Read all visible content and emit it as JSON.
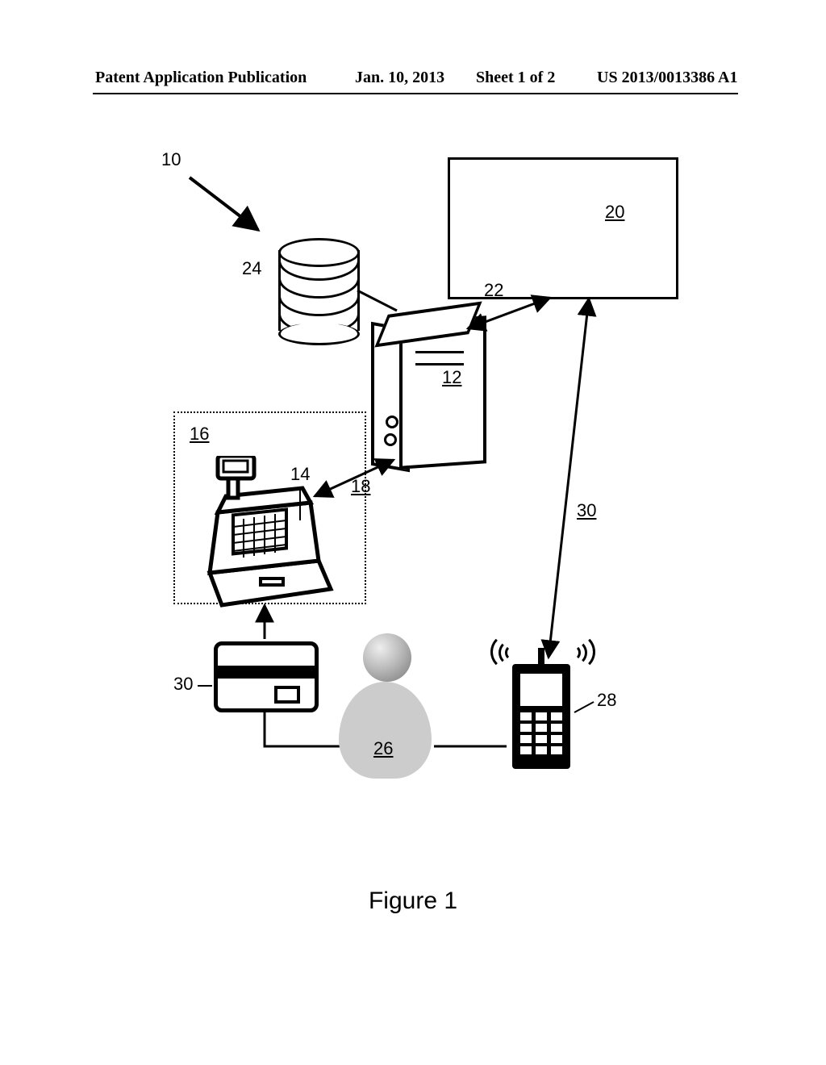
{
  "header": {
    "left": "Patent Application Publication",
    "date": "Jan. 10, 2013",
    "sheet": "Sheet 1 of 2",
    "pubno": "US 2013/0013386 A1"
  },
  "caption": "Figure 1",
  "refs": {
    "r10": "10",
    "r12": "12",
    "r14": "14",
    "r16": "16",
    "r18": "18",
    "r20": "20",
    "r22": "22",
    "r24": "24",
    "r26": "26",
    "r28": "28",
    "r30a": "30",
    "r30b": "30"
  }
}
